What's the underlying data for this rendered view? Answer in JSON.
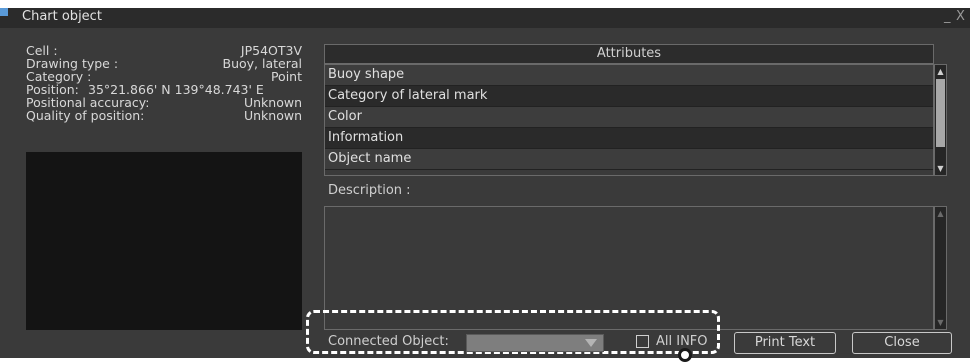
{
  "window": {
    "title": "Chart object",
    "minimize_label": "_",
    "close_label": "X"
  },
  "info": {
    "cell_label": "Cell :",
    "cell_value": "JP54OT3V",
    "drawing_type_label": "Drawing type :",
    "drawing_type_value": "Buoy, lateral",
    "category_label": "Category :",
    "category_value": "Point",
    "position_label": "Position:",
    "position_value": "35°21.866' N  139°48.743' E",
    "positional_accuracy_label": "Positional accuracy:",
    "positional_accuracy_value": "Unknown",
    "quality_label": "Quality of position:",
    "quality_value": "Unknown"
  },
  "attributes": {
    "header": "Attributes",
    "rows": [
      "Buoy shape",
      "Category of lateral mark",
      "Color",
      "Information",
      "Object name"
    ]
  },
  "description": {
    "label": "Description :"
  },
  "footer": {
    "connected_object_label": "Connected Object:",
    "connected_object_value": "",
    "all_info_label": "All INFO",
    "all_info_checked": false,
    "print_text_label": "Print Text",
    "close_label": "Close"
  },
  "colors": {
    "window_bg": "#3a3a3a",
    "titlebar_bg": "#2b2b2b",
    "highlight_frame": "#ffffff"
  }
}
